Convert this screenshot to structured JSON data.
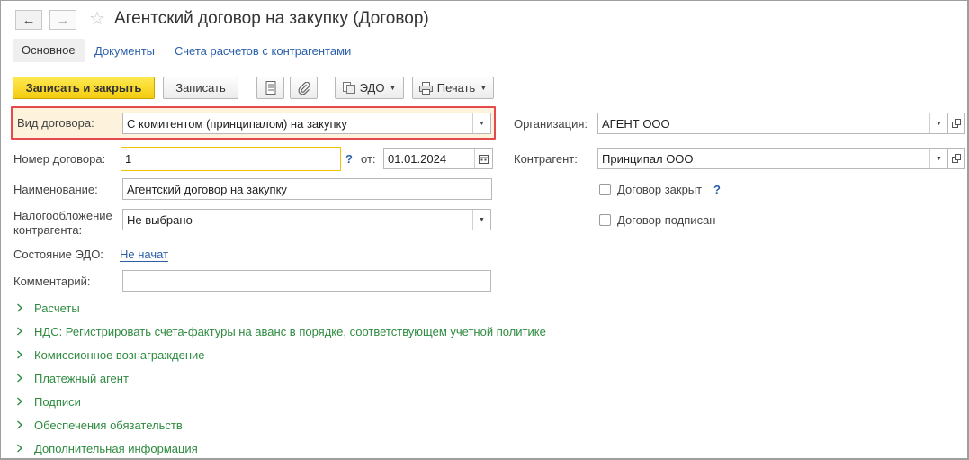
{
  "window": {
    "title": "Агентский договор на закупку (Договор)"
  },
  "tabs": [
    {
      "label": "Основное"
    },
    {
      "label": "Документы"
    },
    {
      "label": "Счета расчетов с контрагентами"
    }
  ],
  "toolbar": {
    "save_close_label": "Записать и закрыть",
    "save_label": "Записать",
    "edo_label": "ЭДО",
    "print_label": "Печать"
  },
  "form": {
    "vid_label": "Вид договора:",
    "vid_value": "С комитентом (принципалом) на закупку",
    "nomer_label": "Номер договора:",
    "nomer_value": "1",
    "help": "?",
    "ot_label": "от:",
    "date_value": "01.01.2024",
    "name_label": "Наименование:",
    "name_value": "Агентский договор на закупку",
    "tax_label_1": "Налогообложение",
    "tax_label_2": "контрагента:",
    "tax_value": "Не выбрано",
    "edo_state_label": "Состояние ЭДО:",
    "edo_state_value": "Не начат",
    "comment_label": "Комментарий:",
    "comment_value": "",
    "org_label": "Организация:",
    "org_value": "АГЕНТ ООО",
    "kontragent_label": "Контрагент:",
    "kontragent_value": "Принципал ООО",
    "closed_label": "Договор закрыт",
    "signed_label": "Договор подписан"
  },
  "groups": [
    {
      "label": "Расчеты"
    },
    {
      "label": "НДС: Регистрировать счета-фактуры на аванс в порядке, соответствующем учетной политике"
    },
    {
      "label": "Комиссионное вознаграждение"
    },
    {
      "label": "Платежный агент"
    },
    {
      "label": "Подписи"
    },
    {
      "label": "Обеспечения обязательств"
    },
    {
      "label": "Дополнительная информация"
    }
  ],
  "colors": {
    "accent_yellow": "#f4cc10",
    "link_blue": "#2a5fa8",
    "group_green": "#2e8b40",
    "highlight_red": "#e5484d"
  }
}
